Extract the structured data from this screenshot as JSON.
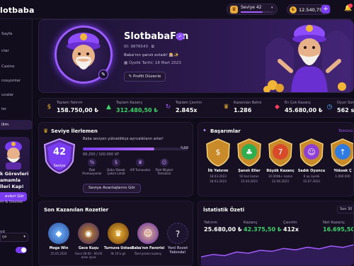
{
  "topbar": {
    "logo": "lotbaba",
    "level_label": "Seviye 42",
    "level_progress": 0.68,
    "balance": "12.540,75 ₺",
    "add_label": "+"
  },
  "sidebar": {
    "items": [
      "Sayfa",
      "nlar",
      "Casino",
      "nosyonlar",
      "uvalar",
      "ler",
      "ilim"
    ],
    "active_index": 6,
    "promo_line1": "k Görevleri",
    "promo_line2": "amamla",
    "promo_line3": "lleri Kap!",
    "promo_button": "evleri Gör",
    "support": "m & Destek",
    "language": "çe",
    "dark_mode_label": "od"
  },
  "profile": {
    "username": "SlotbabaFan",
    "id_line": "ID: 9876543",
    "tagline": "Baba'nın şanslı evladı! 🎰✨",
    "member_since": "Üyelik Tarihi: 18 Mart 2023",
    "edit_button": "Profili Düzenle"
  },
  "stats": [
    {
      "label": "Toplam Yatırım",
      "value": "158.750,00 ₺",
      "icon": "coins-icon",
      "color": "#f1b637",
      "glyph": "$"
    },
    {
      "label": "Toplam Kazanç",
      "value": "312.480,50 ₺",
      "icon": "chart-up-icon",
      "color": "#3fd36a",
      "value_color": "#3fd36a",
      "glyph": "▲"
    },
    {
      "label": "Toplam Çevrim",
      "value": "2.845x",
      "icon": "refresh-icon",
      "color": "#a35cff",
      "glyph": "↻"
    },
    {
      "label": "Kazanılan Bahis",
      "value": "1.286",
      "icon": "trophy-icon",
      "color": "#f1b637",
      "glyph": "♛"
    },
    {
      "label": "En Çok Kazanç",
      "value": "45.680,00 ₺",
      "icon": "gem-icon",
      "color": "#ff3b5c",
      "glyph": "◆"
    },
    {
      "label": "Oyun Süre",
      "value": "562 sa",
      "icon": "clock-icon",
      "color": "#5aa8ff",
      "glyph": "◷"
    }
  ],
  "level_panel": {
    "title": "Seviye İlerlemen",
    "badge_number": "42",
    "badge_label": "Seviye",
    "text": "Baba seviyen yükseldikçe ayrıcalıkların artar!",
    "progress": 0.68,
    "percent_label": "%68",
    "xp": "68.250 / 100.000 XP",
    "perks": [
      "Özel Promosyonlar",
      "Daha Yüksek Çekim Limiti",
      "VIP Turnuvalar",
      "Özel Müşteri Temsilcisi"
    ],
    "button": "Seviye Avantajlarını Gör"
  },
  "achievements": {
    "title": "Başarımlar",
    "see_all": "Tümünü",
    "items": [
      {
        "name": "İlk Yatırım",
        "desc": "18.03.2023",
        "color": "#c98a2a"
      },
      {
        "name": "Şanslı Eller",
        "desc": "50 kez kazan",
        "color": "#2fae4f"
      },
      {
        "name": "Büyük Kazanç",
        "desc": "10.000₺+ kazan",
        "color": "#d94a2b"
      },
      {
        "name": "Sadık Oyuncu",
        "desc": "6 ay üyelik",
        "color": "#8f3fd6"
      },
      {
        "name": "Yüksek Ç",
        "desc": "1.000.000",
        "color": "#2f7be0"
      }
    ],
    "dates": [
      "18.03.2023",
      "15.04.2023",
      "22.06.2023",
      "15.07.2023"
    ]
  },
  "badges_panel": {
    "title": "Son Kazanılan Rozetler",
    "items": [
      {
        "name": "Mega Win",
        "desc": "25.05.2024",
        "icon": "diamond-icon"
      },
      {
        "name": "Gece Kuşu",
        "desc": "Gece 00:00 - 06:00 arası oyna",
        "icon": "owl-icon"
      },
      {
        "name": "Turnuva Ustası",
        "desc": "İlk 10'a gir",
        "icon": "trophy-icon"
      },
      {
        "name": "Baba'nın Favorisi",
        "desc": "Özel promo kazanç",
        "icon": "sultan-icon"
      },
      {
        "name": "Yeni Rozet Yakında!",
        "desc": "",
        "icon": "question-icon"
      }
    ]
  },
  "summary": {
    "title": "İstatistik Özeti",
    "period": "Son 30",
    "cells": [
      {
        "label": "Yatırım",
        "value": "25.680,00 ₺",
        "color": "#ffffff"
      },
      {
        "label": "Kazanç",
        "value": "42.375,50 ₺",
        "color": "#3fd36a"
      },
      {
        "label": "Çevrim",
        "value": "412x",
        "color": "#ffffff"
      },
      {
        "label": "Net Kazanç",
        "value": "16.695,50 ₺",
        "color": "#3fd36a"
      }
    ],
    "sparkline": [
      0.35,
      0.45,
      0.4,
      0.55,
      0.5,
      0.62,
      0.58,
      0.7,
      0.64,
      0.75,
      0.68,
      0.8,
      0.74,
      0.86
    ]
  }
}
